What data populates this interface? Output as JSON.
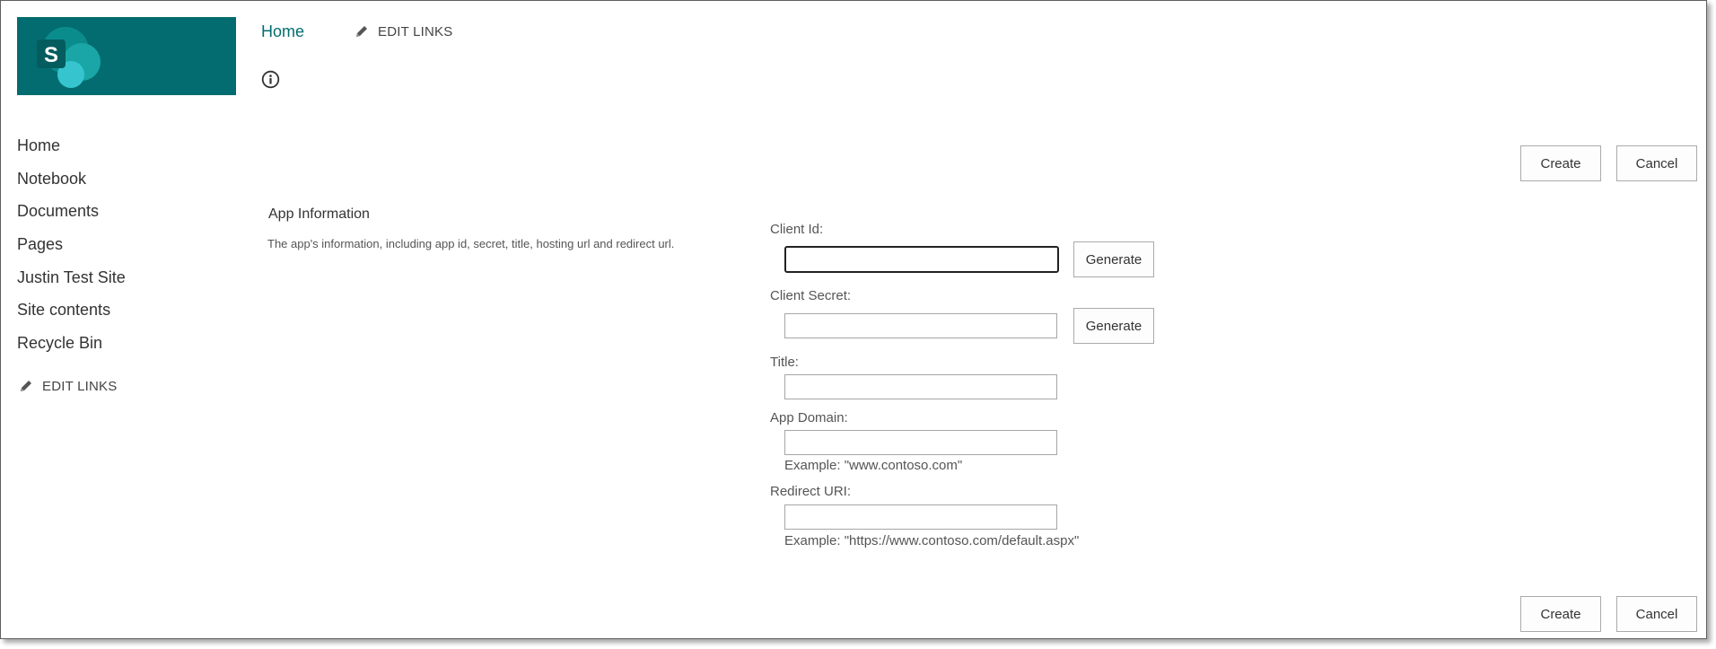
{
  "topnav": {
    "home": "Home",
    "edit_links": "EDIT LINKS"
  },
  "leftnav": {
    "items": [
      {
        "label": "Home"
      },
      {
        "label": "Notebook"
      },
      {
        "label": "Documents"
      },
      {
        "label": "Pages"
      },
      {
        "label": "Justin Test Site"
      },
      {
        "label": "Site contents"
      },
      {
        "label": "Recycle Bin"
      }
    ],
    "edit_links": "EDIT LINKS"
  },
  "actions": {
    "create": "Create",
    "cancel": "Cancel"
  },
  "section": {
    "title": "App Information",
    "description": "The app's information, including app id, secret, title, hosting url and redirect url."
  },
  "form": {
    "client_id": {
      "label": "Client Id:",
      "value": "",
      "generate": "Generate"
    },
    "client_secret": {
      "label": "Client Secret:",
      "value": "",
      "generate": "Generate"
    },
    "title": {
      "label": "Title:",
      "value": ""
    },
    "app_domain": {
      "label": "App Domain:",
      "value": "",
      "example": "Example: \"www.contoso.com\""
    },
    "redirect_uri": {
      "label": "Redirect URI:",
      "value": "",
      "example": "Example: \"https://www.contoso.com/default.aspx\""
    }
  },
  "colors": {
    "brand": "#036c70",
    "logo_circle": "#36c5cf"
  },
  "icons": {
    "logo": "sharepoint-logo-icon",
    "info": "info-icon",
    "edit": "pencil-icon"
  }
}
